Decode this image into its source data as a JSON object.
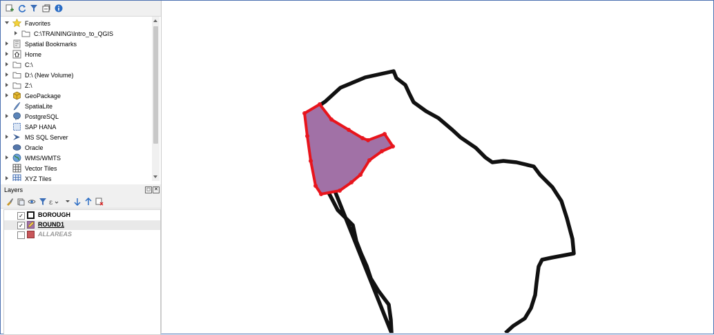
{
  "browser": {
    "toolbar": [
      "add-layer",
      "refresh",
      "filter",
      "collapse",
      "info"
    ],
    "items": [
      {
        "label": "Favorites",
        "icon": "star-icon",
        "expanded": true
      },
      {
        "label": "C:\\TRAINING\\Intro_to_QGIS",
        "icon": "folder-icon"
      },
      {
        "label": "Spatial Bookmarks",
        "icon": "bookmark-icon"
      },
      {
        "label": "Home",
        "icon": "home-icon"
      },
      {
        "label": "C:\\",
        "icon": "folder-icon"
      },
      {
        "label": "D:\\ (New Volume)",
        "icon": "folder-icon"
      },
      {
        "label": "Z:\\",
        "icon": "folder-icon"
      },
      {
        "label": "GeoPackage",
        "icon": "geopackage-icon"
      },
      {
        "label": "SpatiaLite",
        "icon": "spatialite-icon"
      },
      {
        "label": "PostgreSQL",
        "icon": "postgresql-icon"
      },
      {
        "label": "SAP HANA",
        "icon": "sap-hana-icon"
      },
      {
        "label": "MS SQL Server",
        "icon": "mssql-icon"
      },
      {
        "label": "Oracle",
        "icon": "oracle-icon"
      },
      {
        "label": "WMS/WMTS",
        "icon": "globe-icon"
      },
      {
        "label": "Vector Tiles",
        "icon": "grid-icon"
      },
      {
        "label": "XYZ Tiles",
        "icon": "grid-icon"
      }
    ]
  },
  "layers_panel": {
    "title": "Layers",
    "layers": [
      {
        "name": "BOROUGH",
        "checked": true,
        "style": "outline"
      },
      {
        "name": "ROUND1",
        "checked": true,
        "style": "editing"
      },
      {
        "name": "ALLAREAS",
        "checked": false,
        "style": "fill"
      }
    ]
  },
  "colors": {
    "borough_outline": "#111111",
    "round1_fill": "#a171a6",
    "round1_outline": "#e8141c",
    "allareas_fill": "#c8565a",
    "panel_bg": "#f0f0f0",
    "frame_border": "#4a6fb0"
  }
}
